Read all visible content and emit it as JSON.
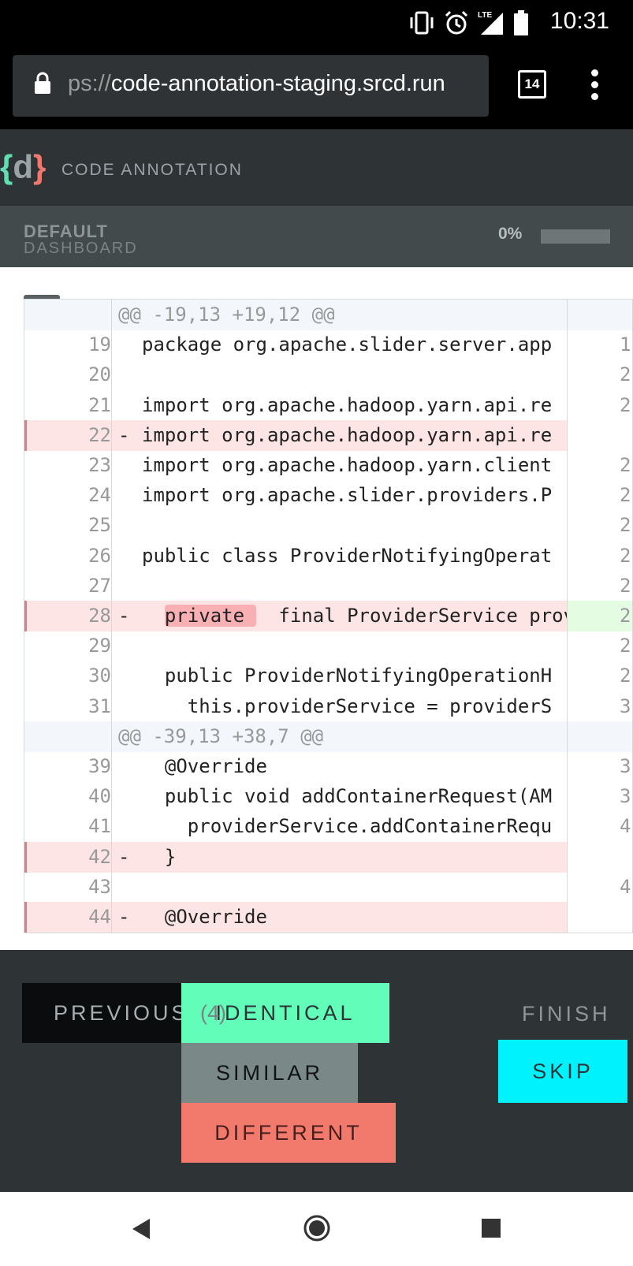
{
  "status_bar": {
    "time": "10:31",
    "icons": [
      "vibrate-icon",
      "alarm-icon",
      "lte-signal-icon",
      "battery-icon"
    ],
    "network_label": "LTE"
  },
  "browser": {
    "url_prefix": "ps://",
    "url_host": "code-annotation-staging.srcd.run",
    "tab_count": "14"
  },
  "app": {
    "logo_open": "{",
    "logo_letter": "d",
    "logo_close": "}",
    "title": "CODE ANNOTATION"
  },
  "dashboard": {
    "line1": "DEFAULT",
    "line2": "DASHBOARD",
    "progress_label": "0%",
    "progress_fraction": 0
  },
  "diff": {
    "rows": [
      {
        "type": "hunk",
        "left": "",
        "marker": "",
        "code": "@@ -19,13 +19,12 @@",
        "right": ""
      },
      {
        "type": "ctx",
        "left": "19",
        "marker": "",
        "code": "package org.apache.slider.server.app",
        "right": "1"
      },
      {
        "type": "ctx",
        "left": "20",
        "marker": "",
        "code": "",
        "right": "2"
      },
      {
        "type": "ctx",
        "left": "21",
        "marker": "",
        "code": "import org.apache.hadoop.yarn.api.re",
        "right": "2"
      },
      {
        "type": "del",
        "left": "22",
        "marker": "-",
        "code": "import org.apache.hadoop.yarn.api.re",
        "right": ""
      },
      {
        "type": "ctx",
        "left": "23",
        "marker": "",
        "code": "import org.apache.hadoop.yarn.client",
        "right": "2"
      },
      {
        "type": "ctx",
        "left": "24",
        "marker": "",
        "code": "import org.apache.slider.providers.P",
        "right": "2"
      },
      {
        "type": "ctx",
        "left": "25",
        "marker": "",
        "code": "",
        "right": "2"
      },
      {
        "type": "ctx",
        "left": "26",
        "marker": "",
        "code": "public class ProviderNotifyingOperat",
        "right": "2"
      },
      {
        "type": "ctx",
        "left": "27",
        "marker": "",
        "code": "",
        "right": "2"
      },
      {
        "type": "del",
        "left": "28",
        "marker": "-",
        "code_highlight": "private ",
        "code": "  final ProviderService prov",
        "indent": "  ",
        "right": "2",
        "right_add": true
      },
      {
        "type": "ctx",
        "left": "29",
        "marker": "",
        "code": "",
        "right": "2"
      },
      {
        "type": "ctx",
        "left": "30",
        "marker": "",
        "code": "  public ProviderNotifyingOperationH",
        "right": "2"
      },
      {
        "type": "ctx",
        "left": "31",
        "marker": "",
        "code": "    this.providerService = providerS",
        "right": "3"
      },
      {
        "type": "hunk",
        "left": "",
        "marker": "",
        "code": "@@ -39,13 +38,7 @@",
        "right": ""
      },
      {
        "type": "ctx",
        "left": "39",
        "marker": "",
        "code": "  @Override",
        "right": "3"
      },
      {
        "type": "ctx",
        "left": "40",
        "marker": "",
        "code": "  public void addContainerRequest(AM",
        "right": "3"
      },
      {
        "type": "ctx",
        "left": "41",
        "marker": "",
        "code": "    providerService.addContainerRequ",
        "right": "4"
      },
      {
        "type": "del",
        "left": "42",
        "marker": "-",
        "code": "  }",
        "right": ""
      },
      {
        "type": "ctx",
        "left": "43",
        "marker": "",
        "code": "",
        "right": "4"
      },
      {
        "type": "del",
        "left": "44",
        "marker": "-",
        "code": "  @Override",
        "right": ""
      }
    ]
  },
  "controls": {
    "previous_label": "PREVIOUS",
    "previous_count": "(4)",
    "identical_label": "IDENTICAL",
    "similar_label": "SIMILAR",
    "different_label": "DIFFERENT",
    "finish_label": "FINISH",
    "skip_label": "SKIP"
  },
  "colors": {
    "identical": "#62fdb8",
    "similar": "#7b8888",
    "different": "#f27a6c",
    "skip": "#00f2fc",
    "header_bg": "#2e3436"
  }
}
